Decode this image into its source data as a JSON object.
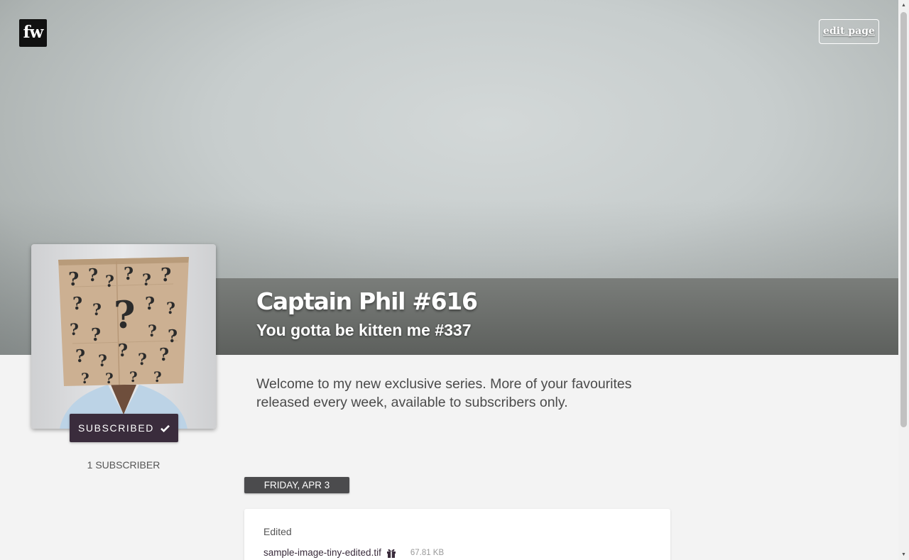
{
  "brand": {
    "logo_text": "fw"
  },
  "header": {
    "edit_label": "edit page"
  },
  "profile": {
    "title": "Captain Phil #616",
    "subtitle": "You gotta be kitten me #337",
    "description": "Welcome to my new exclusive series. More of your favourites released every week, available to subscribers only.",
    "subscribe_label": "SUBSCRIBED",
    "subscriber_count": "1 SUBSCRIBER"
  },
  "feed": {
    "date": "FRIDAY, APR 3",
    "posts": [
      {
        "title": "Edited",
        "file_name": "sample-image-tiny-edited.tif",
        "file_size": "67.81 KB"
      }
    ]
  },
  "colors": {
    "accent": "#3a2c3c",
    "title_band": "#6b6e6b",
    "date_pill": "#4b4b4d"
  },
  "icons": {
    "subscribe": "check-icon",
    "file": "gift-icon"
  }
}
